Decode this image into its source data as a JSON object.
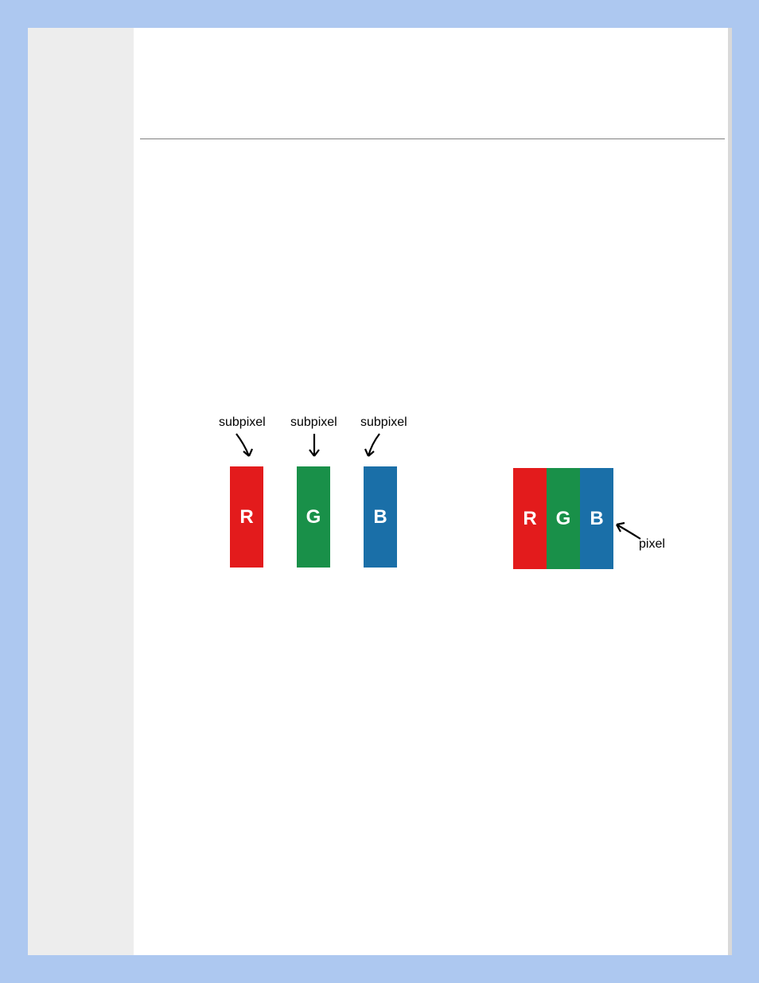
{
  "diagram": {
    "left": {
      "subpixels": [
        {
          "letter": "R",
          "label": "subpixel",
          "color": "#e31b1c"
        },
        {
          "letter": "G",
          "label": "subpixel",
          "color": "#199049"
        },
        {
          "letter": "B",
          "label": "subpixel",
          "color": "#1a6fa8"
        }
      ]
    },
    "right": {
      "pixel_label": "pixel",
      "subpixels": [
        {
          "letter": "R",
          "color": "#e31b1c"
        },
        {
          "letter": "G",
          "color": "#199049"
        },
        {
          "letter": "B",
          "color": "#1a6fa8"
        }
      ]
    }
  }
}
